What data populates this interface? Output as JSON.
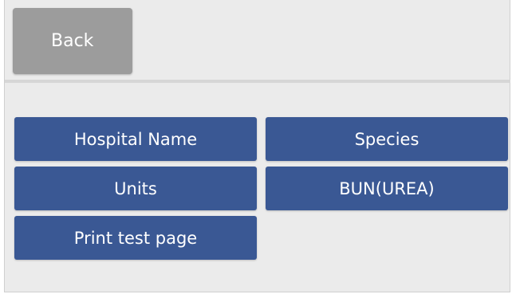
{
  "header": {
    "back_label": "Back"
  },
  "menu": {
    "items": [
      {
        "label": "Hospital Name"
      },
      {
        "label": "Species"
      },
      {
        "label": "Units"
      },
      {
        "label": "BUN(UREA)"
      },
      {
        "label": "Print test page"
      }
    ]
  },
  "colors": {
    "background": "#ebebeb",
    "back_button": "#9c9c9c",
    "menu_button": "#3a5894",
    "text": "#ffffff"
  }
}
